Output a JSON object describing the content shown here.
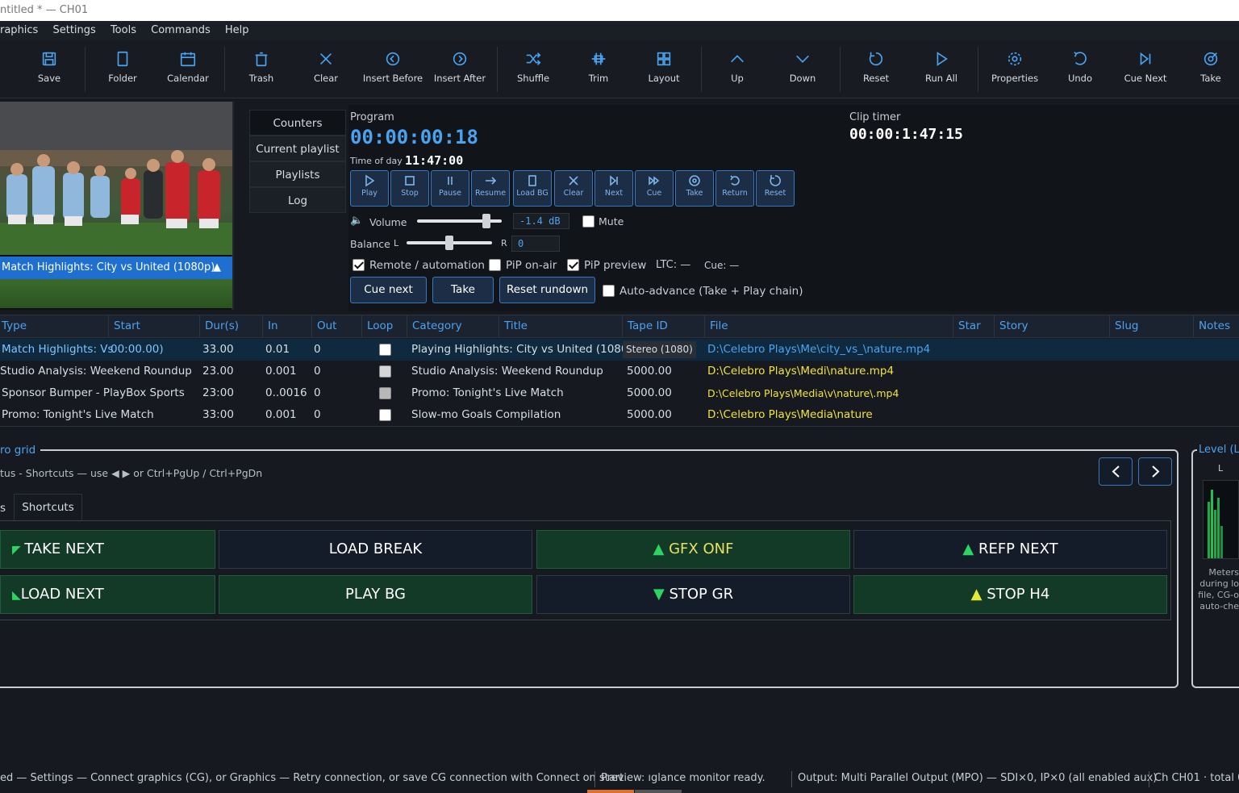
{
  "window": {
    "title": "ntitled * — CH01"
  },
  "menu": [
    "raphics",
    "Settings",
    "Tools",
    "Commands",
    "Help"
  ],
  "toolbar": [
    {
      "label": "Save",
      "icon": "save-icon"
    },
    {
      "label": "Folder",
      "icon": "folder-icon"
    },
    {
      "label": "Calendar",
      "icon": "calendar-icon"
    },
    {
      "label": "Trash",
      "icon": "trash-icon"
    },
    {
      "label": "Clear",
      "icon": "close-icon"
    },
    {
      "label": "Insert Before",
      "icon": "insert-before-icon"
    },
    {
      "label": "Insert After",
      "icon": "insert-after-icon"
    },
    {
      "label": "Shuffle",
      "icon": "shuffle-icon"
    },
    {
      "label": "Trim",
      "icon": "trim-icon"
    },
    {
      "label": "Layout",
      "icon": "layout-icon"
    },
    {
      "label": "Up",
      "icon": "chevron-up-icon"
    },
    {
      "label": "Down",
      "icon": "chevron-down-icon"
    },
    {
      "label": "Reset",
      "icon": "reset-icon"
    },
    {
      "label": "Run All",
      "icon": "play-icon"
    },
    {
      "label": "Properties",
      "icon": "gear-icon"
    },
    {
      "label": "Undo",
      "icon": "undo-icon"
    },
    {
      "label": "Cue Next",
      "icon": "skip-next-icon"
    },
    {
      "label": "Take",
      "icon": "take-icon"
    }
  ],
  "preview": {
    "caption": "Match Highlights: City vs United (1080p)"
  },
  "side_tabs": [
    "Counters",
    "Current playlist",
    "Playlists",
    "Log"
  ],
  "program": {
    "label": "Program",
    "timecode": "00:00:00:18",
    "tod_label": "Time of day",
    "tod": "11:47:00",
    "clip_label": "Clip timer",
    "clip_time": "00:00:1:47:15"
  },
  "transport": [
    {
      "label": "Play",
      "icon": "play-icon"
    },
    {
      "label": "Stop",
      "icon": "stop-icon"
    },
    {
      "label": "Pause",
      "icon": "pause-icon"
    },
    {
      "label": "Resume",
      "icon": "resume-icon"
    },
    {
      "label": "Load BG",
      "icon": "load-bg-icon"
    },
    {
      "label": "Clear",
      "icon": "close-icon"
    },
    {
      "label": "Next",
      "icon": "skip-next-icon"
    },
    {
      "label": "Cue",
      "icon": "cue-icon"
    },
    {
      "label": "Take",
      "icon": "take-icon"
    },
    {
      "label": "Return",
      "icon": "return-icon"
    },
    {
      "label": "Reset",
      "icon": "reset-icon"
    }
  ],
  "audio": {
    "volume_label": "Volume",
    "volume_value": "-1.4 dB",
    "volume_level": 0.82,
    "mute_label": "Mute",
    "balance_label": "Balance",
    "balance_l": "L",
    "balance_r": "R",
    "balance_value": "0",
    "balance_level": 0.5
  },
  "options": {
    "remote": "Remote / automation",
    "pip_onair": "PiP on-air",
    "pip_preview": "PiP preview",
    "ltc": "LTC: —",
    "cue": "Cue: —",
    "auto_advance": "Auto-advance (Take + Play chain)"
  },
  "playlist_buttons": {
    "cue_next": "Cue next",
    "take": "Take",
    "reset": "Reset rundown"
  },
  "grid": {
    "columns": [
      "Type",
      "Start",
      "Dur(s)",
      "In",
      "Out",
      "Loop",
      "Category",
      "Title",
      "Tape ID",
      "File",
      "Star",
      "Story",
      "Slug",
      "Notes"
    ],
    "rows": [
      {
        "type": "Match Highlights: Vs",
        "start": "00:00.00)",
        "dur": "33.00",
        "in": "0.01",
        "out": "0",
        "title": "Playing Highlights: City vs United (1080p)",
        "tape": "Stereo (1080)",
        "file": "D:\\Celebro Plays\\Me\\city_vs_\\nature.mp4"
      },
      {
        "type": "Studio Analysis: Weekend Roundup",
        "start": "",
        "dur": "23.00",
        "in": "0.001",
        "out": "0",
        "title": "Studio Analysis: Weekend Roundup",
        "tape": "5000.00",
        "file": "D:\\Celebro Plays\\Medi\\nature.mp4"
      },
      {
        "type": "Sponsor Bumper - PlayBox Sports",
        "start": "",
        "dur": "23:00",
        "in": "0..0016",
        "out": "0",
        "title": "Promo: Tonight's Live Match",
        "tape": "5000.00",
        "file": "D:\\Celebro Plays\\Media\\v\\nature\\.mp4"
      },
      {
        "type": "Promo: Tonight's Live Match",
        "start": "",
        "dur": "33:00",
        "in": "0.001",
        "out": "0",
        "title": "Slow-mo Goals Compilation",
        "tape": "5000.00",
        "file": "D:\\Celebro Plays\\Media\\nature"
      }
    ]
  },
  "macro": {
    "title": "ro grid",
    "hint": "tus - Shortcuts — use ◀ ▶ or Ctrl+PgUp / Ctrl+PgDn",
    "tab_prev": "s",
    "tab_active": "Shortcuts",
    "buttons": [
      {
        "label": "TAKE NEXT",
        "style": "g"
      },
      {
        "label": "LOAD BREAK",
        "style": "d"
      },
      {
        "label": "GFX ONF",
        "style": "g"
      },
      {
        "label": "REFP NEXT",
        "style": "d"
      },
      {
        "label": "LOAD NEXT",
        "style": "d"
      },
      {
        "label": "PLAY BG",
        "style": "g"
      },
      {
        "label": "STOP GR",
        "style": "d"
      },
      {
        "label": "STOP H4",
        "style": "g"
      }
    ]
  },
  "level": {
    "title": "Level (L",
    "channel": "L",
    "note": "Meters during lo file, CG-o auto-che"
  },
  "status": {
    "left": "ed — Settings — Connect graphics (CG), or Graphics — Retry connection, or save CG connection with Connect on start",
    "preview": "Preview: ıglance monitor ready.",
    "output": "Output: Multi Parallel Output (MPO) — SDI×0, IP×0 (all enabled aux)",
    "channel": "Ch CH01 · total 0"
  },
  "colors": {
    "accent": "#4aa3f0",
    "selection": "#1f6fd0",
    "file_text": "#f2e33a",
    "green_button": "#133a27"
  }
}
